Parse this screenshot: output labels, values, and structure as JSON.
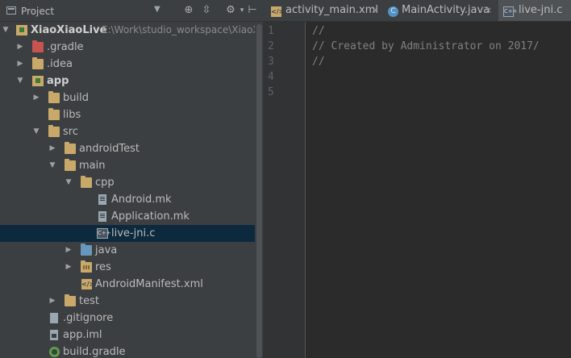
{
  "project_panel": {
    "title": "Project",
    "tree": [
      {
        "label": "XiaoXiaoLive",
        "extra": "E:\\Work\\studio_workspace\\XiaoXia",
        "icon": "module-folder-icon",
        "expanded": true,
        "depth": 0
      },
      {
        "label": ".gradle",
        "icon": "folder-icon",
        "expanded": false,
        "depth": 1
      },
      {
        "label": ".idea",
        "icon": "folder-icon",
        "expanded": false,
        "depth": 1
      },
      {
        "label": "app",
        "icon": "module-folder-icon",
        "expanded": true,
        "depth": 1
      },
      {
        "label": "build",
        "icon": "folder-icon",
        "expanded": false,
        "depth": 2
      },
      {
        "label": "libs",
        "icon": "folder-icon",
        "depth": 2
      },
      {
        "label": "src",
        "icon": "folder-icon",
        "expanded": true,
        "depth": 2
      },
      {
        "label": "androidTest",
        "icon": "folder-icon",
        "expanded": false,
        "depth": 3
      },
      {
        "label": "main",
        "icon": "folder-icon",
        "expanded": true,
        "depth": 3
      },
      {
        "label": "cpp",
        "icon": "folder-icon",
        "expanded": true,
        "depth": 4
      },
      {
        "label": "Android.mk",
        "icon": "text-file-icon",
        "depth": 5
      },
      {
        "label": "Application.mk",
        "icon": "text-file-icon",
        "depth": 5
      },
      {
        "label": "live-jni.c",
        "icon": "c-file-icon",
        "depth": 5,
        "selected": true
      },
      {
        "label": "java",
        "icon": "source-folder-icon",
        "expanded": false,
        "depth": 4
      },
      {
        "label": "res",
        "icon": "resource-folder-icon",
        "expanded": false,
        "depth": 4
      },
      {
        "label": "AndroidManifest.xml",
        "icon": "xml-file-icon",
        "depth": 4
      },
      {
        "label": "test",
        "icon": "folder-icon",
        "expanded": false,
        "depth": 3
      },
      {
        "label": ".gitignore",
        "icon": "text-file-icon",
        "depth": 2
      },
      {
        "label": "app.iml",
        "icon": "iml-file-icon",
        "depth": 2
      },
      {
        "label": "build.gradle",
        "icon": "gradle-file-icon",
        "depth": 2
      }
    ]
  },
  "editor": {
    "tabs": [
      {
        "label": "activity_main.xml",
        "icon": "xml-file-icon",
        "active": false
      },
      {
        "label": "MainActivity.java",
        "icon": "java-class-icon",
        "active": false
      },
      {
        "label": "live-jni.c",
        "icon": "c-file-icon",
        "active": true
      }
    ],
    "close_glyph": "×",
    "lines": [
      {
        "n": "1",
        "text": "//"
      },
      {
        "n": "2",
        "text": "// Created by Administrator on 2017/"
      },
      {
        "n": "3",
        "text": "//"
      },
      {
        "n": "4",
        "text": ""
      },
      {
        "n": "5",
        "text": ""
      }
    ]
  },
  "colors": {
    "panel_bg": "#3c3f41",
    "editor_bg": "#2b2b2b",
    "selection": "#0d293e",
    "comment": "#808080"
  }
}
